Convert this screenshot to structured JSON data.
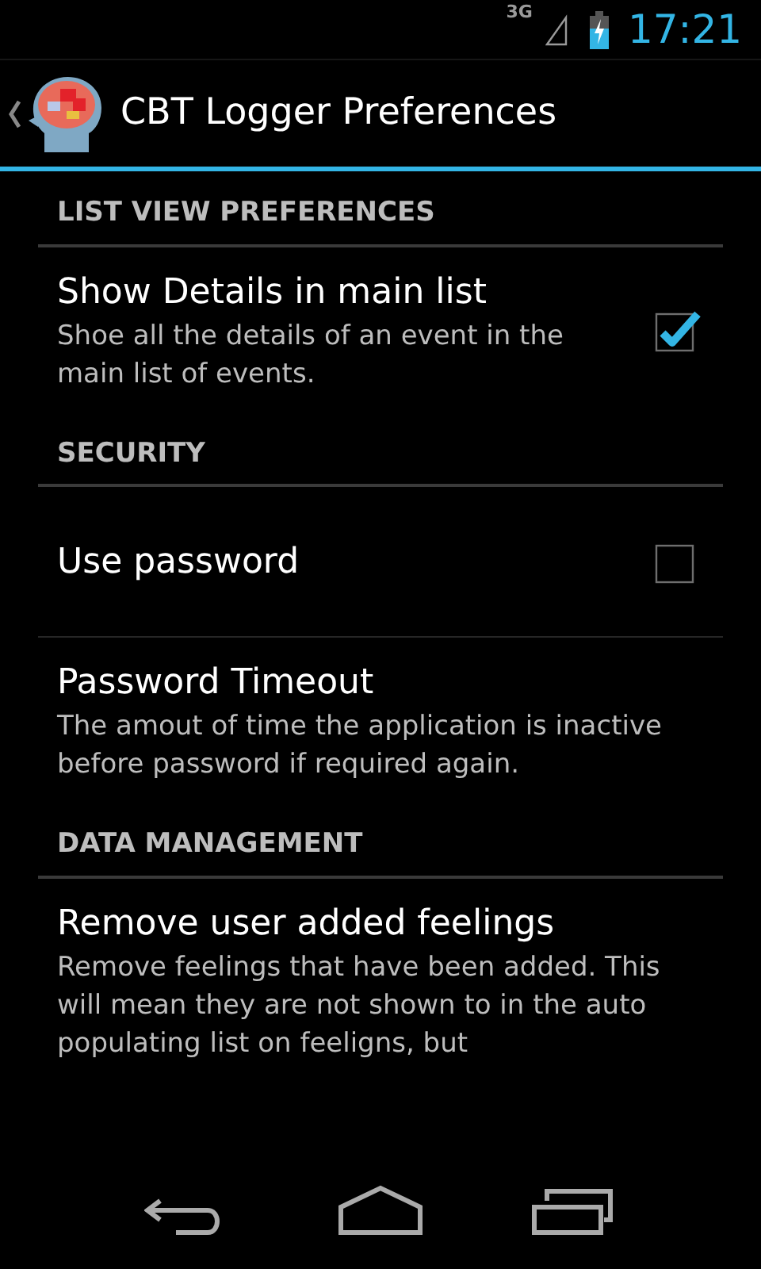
{
  "status_bar": {
    "network": "3G",
    "time": "17:21"
  },
  "action_bar": {
    "title": "CBT Logger Preferences"
  },
  "sections": [
    {
      "title": "LIST VIEW PREFERENCES",
      "items": [
        {
          "kind": "checkbox",
          "title": "Show Details in main list",
          "summary": "Shoe all the details of an event in the main list of events.",
          "checked": true
        }
      ]
    },
    {
      "title": "SECURITY",
      "items": [
        {
          "kind": "checkbox",
          "title": "Use password",
          "checked": false
        },
        {
          "kind": "plain",
          "title": "Password Timeout",
          "summary": "The amout of time the application is inactive before password if required again."
        }
      ]
    },
    {
      "title": "DATA MANAGEMENT",
      "items": [
        {
          "kind": "plain",
          "title": "Remove user added feelings",
          "summary": "Remove feelings that have been added. This will mean they are not shown to in the auto populating list on feeligns, but"
        }
      ]
    }
  ]
}
